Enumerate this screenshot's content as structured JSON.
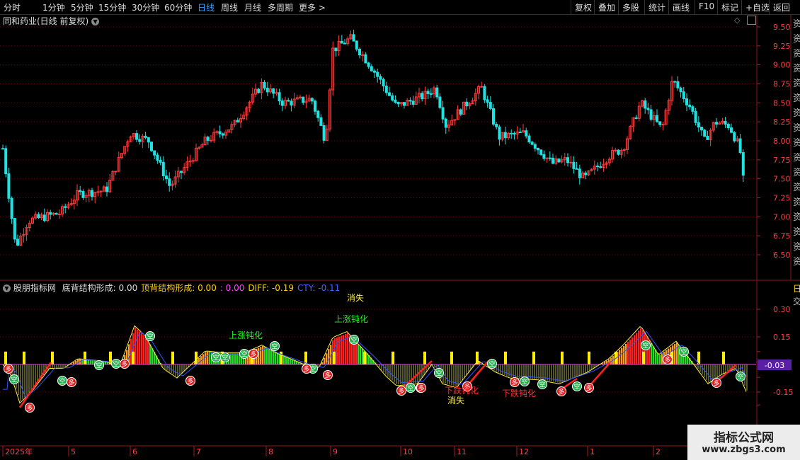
{
  "toolbar": {
    "periods": [
      "分时",
      "1分钟",
      "5分钟",
      "15分钟",
      "30分钟",
      "60分钟",
      "日线",
      "周线",
      "月线",
      "多周期",
      "更多 >"
    ],
    "active": "日线",
    "right_buttons": [
      "复权",
      "叠加",
      "多股",
      "统计",
      "画线",
      "F10",
      "标记",
      "+自选",
      "返回"
    ]
  },
  "main_chart": {
    "title": "同和药业(日线 前复权)",
    "y_ticks": [
      "9.50",
      "9.25",
      "9.00",
      "8.75",
      "8.50",
      "8.25",
      "8.00",
      "7.75",
      "7.50",
      "7.25",
      "7.00",
      "6.75",
      "6.50"
    ],
    "y_range": [
      6.3,
      9.65
    ],
    "up_color": "#ff3b3b",
    "down_color": "#1ee3e3"
  },
  "indicator": {
    "name": "股朋指标网",
    "fields": [
      {
        "label": "底背结构形成:",
        "value": "0.00",
        "color": "#dcdcdc"
      },
      {
        "label": "顶背结构形成:",
        "value": "0.00",
        "color": "#ffd000"
      },
      {
        "label": ":",
        "value": "0.00",
        "color": "#ff44ff"
      },
      {
        "label": "DIFF:",
        "value": "-0.19",
        "color": "#ffd000"
      },
      {
        "label": "CTY:",
        "value": "-0.11",
        "color": "#4466ff"
      }
    ],
    "y_ticks": [
      "0.30",
      "0.15",
      "-0.15"
    ],
    "current_value": "-0.03",
    "annotations": {
      "disappear": "消失",
      "up_dull": "上涨钝化",
      "down_dull": "下跌钝化",
      "empty_mark": "空",
      "buy_mark": "多"
    }
  },
  "right_panel": {
    "chars": [
      "资",
      "资",
      "资",
      "资",
      "资",
      "资",
      "资",
      "资",
      "资",
      "资",
      "资",
      "资",
      "资",
      "资",
      "资",
      "资",
      "资"
    ],
    "partial": "日"
  },
  "time_axis": {
    "labels": [
      "2025年",
      "5",
      "6",
      "7",
      "8",
      "9",
      "10",
      "11",
      "12",
      "1",
      "2"
    ]
  },
  "watermark": {
    "title": "指标公式网",
    "url": "www.zbgs3.com"
  }
}
